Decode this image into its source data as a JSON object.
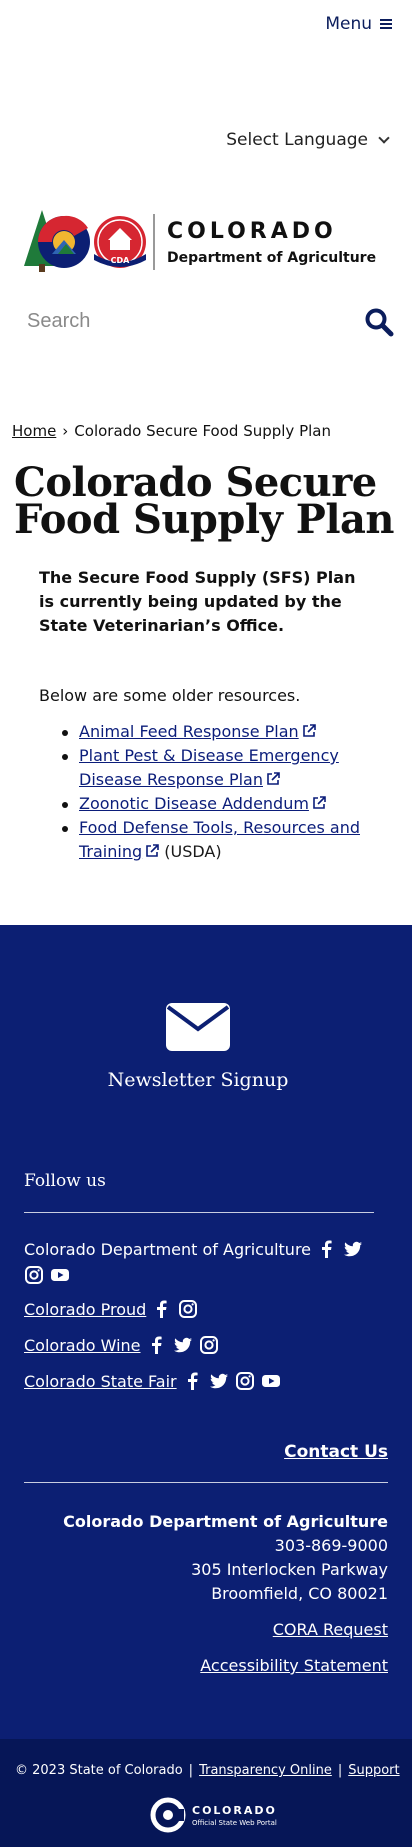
{
  "header": {
    "menu_label": "Menu",
    "language_label": "Select Language",
    "logo": {
      "name": "COLORADO",
      "dept": "Department of Agriculture",
      "badge": "CDA"
    },
    "search": {
      "placeholder": "Search"
    }
  },
  "breadcrumb": {
    "home": "Home",
    "separator": "›",
    "current": "Colorado Secure Food Supply Plan"
  },
  "main": {
    "title": "Colorado Secure Food Supply Plan",
    "intro": "The Secure Food Supply (SFS) Plan is currently being updated by the State Veterinarian’s Office.",
    "older_text": "Below are some older resources.",
    "resources": [
      {
        "label": "Animal Feed Response Plan",
        "suffix": ""
      },
      {
        "label": "Plant Pest & Disease Emergency Disease Response Plan",
        "suffix": ""
      },
      {
        "label": "Zoonotic Disease Addendum",
        "suffix": ""
      },
      {
        "label": "Food Defense Tools, Resources and Training",
        "suffix": "(USDA)"
      }
    ]
  },
  "footer": {
    "newsletter": "Newsletter Signup",
    "follow_us": "Follow us",
    "social": [
      {
        "label": "Colorado Department of Agriculture",
        "linked": false,
        "icons": [
          "facebook-icon",
          "twitter-icon",
          "instagram-icon",
          "youtube-icon"
        ]
      },
      {
        "label": "Colorado Proud",
        "linked": true,
        "icons": [
          "facebook-icon",
          "instagram-icon"
        ]
      },
      {
        "label": "Colorado Wine",
        "linked": true,
        "icons": [
          "facebook-icon",
          "twitter-icon",
          "instagram-icon"
        ]
      },
      {
        "label": "Colorado State Fair",
        "linked": true,
        "icons": [
          "facebook-icon",
          "twitter-icon",
          "instagram-icon",
          "youtube-icon"
        ]
      }
    ],
    "contact_us": "Contact Us",
    "address": {
      "dept": "Colorado Department of Agriculture",
      "phone": "303-869-9000",
      "street": "305 Interlocken Parkway",
      "city": "Broomfield, CO 80021"
    },
    "cora": "CORA Request",
    "accessibility": "Accessibility Statement"
  },
  "subfooter": {
    "copyright": "© 2023 State of Colorado",
    "sep": "|",
    "transparency": "Transparency Online",
    "support": "Support",
    "portal_title": "COLORADO",
    "portal_sub": "Official State Web Portal"
  },
  "colors": {
    "brand_navy": "#0c1f73",
    "link_blue": "#0b1d7a",
    "subfooter_navy": "#061657"
  }
}
